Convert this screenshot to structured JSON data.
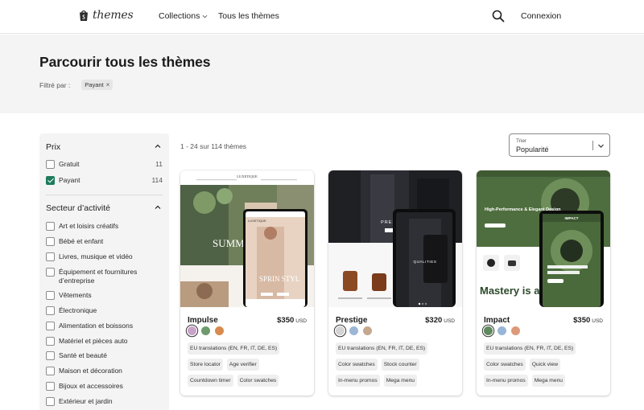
{
  "header": {
    "logo_text": "themes",
    "nav": [
      {
        "label": "Collections",
        "icon": "chevron-down-icon"
      },
      {
        "label": "Tous les thèmes"
      }
    ],
    "search_icon": "search-icon",
    "login_label": "Connexion"
  },
  "hero": {
    "title": "Parcourir tous les thèmes",
    "filter_label": "Filtré par :",
    "active_filters": [
      {
        "label": "Payant",
        "remove_icon": "close-icon"
      }
    ]
  },
  "sidebar": {
    "price": {
      "title": "Prix",
      "options": [
        {
          "label": "Gratuit",
          "count": "11",
          "checked": false
        },
        {
          "label": "Payant",
          "count": "114",
          "checked": true
        }
      ]
    },
    "sector": {
      "title": "Secteur d’activité",
      "options": [
        {
          "label": "Art et loisirs créatifs",
          "checked": false
        },
        {
          "label": "Bébé et enfant",
          "checked": false
        },
        {
          "label": "Livres, musique et vidéo",
          "checked": false
        },
        {
          "label": "Équipement et fournitures d’entreprise",
          "checked": false
        },
        {
          "label": "Vêtements",
          "checked": false
        },
        {
          "label": "Électronique",
          "checked": false
        },
        {
          "label": "Alimentation et boissons",
          "checked": false
        },
        {
          "label": "Matériel et pièces auto",
          "checked": false
        },
        {
          "label": "Santé et beauté",
          "checked": false
        },
        {
          "label": "Maison et décoration",
          "checked": false
        },
        {
          "label": "Bijoux et accessoires",
          "checked": false
        },
        {
          "label": "Extérieur et jardin",
          "checked": false
        }
      ]
    }
  },
  "results": {
    "count_text": "1 - 24 sur 114 thèmes",
    "sort": {
      "label": "Trier",
      "value": "Popularité"
    }
  },
  "themes": [
    {
      "name": "Impulse",
      "price": "$350",
      "currency": "USD",
      "swatches": [
        "#c9a3c9",
        "#6e9a6e",
        "#d98a4e"
      ],
      "tags": [
        "EU translations (EN, FR, IT, DE, ES)",
        "Store locator",
        "Age verifier",
        "Countdown timer",
        "Color swatches"
      ],
      "preview_text": {
        "brand": "LUXETIQUE",
        "hero_big": "SUMM",
        "hero_alt": "SPRIN STYL"
      }
    },
    {
      "name": "Prestige",
      "price": "$320",
      "currency": "USD",
      "swatches": [
        "#d4d4d4",
        "#9cb7d6",
        "#c4a890"
      ],
      "tags": [
        "EU translations (EN, FR, IT, DE, ES)",
        "Color swatches",
        "Stock counter",
        "In-menu promos",
        "Mega menu"
      ],
      "preview_text": {
        "brand": "PRESTIGE",
        "sub": "QUALITIES"
      }
    },
    {
      "name": "Impact",
      "price": "$350",
      "currency": "USD",
      "swatches": [
        "#5e8a5e",
        "#98b6d8",
        "#dc9a7a"
      ],
      "tags": [
        "EU translations (EN, FR, IT, DE, ES)",
        "Color swatches",
        "Quick view",
        "In-menu promos",
        "Mega menu"
      ],
      "preview_text": {
        "brand": "IMPACT",
        "headline": "High-Performance & Elegant Design",
        "mastery": "Mastery is a"
      }
    }
  ]
}
